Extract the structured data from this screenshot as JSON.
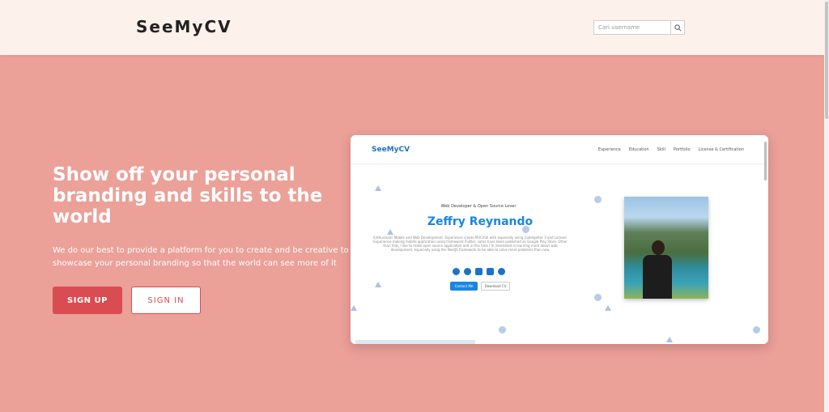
{
  "header": {
    "logo": "SeeMyCV",
    "search_placeholder": "Cari username",
    "search_icon": "search-icon"
  },
  "hero": {
    "title": "Show off your personal branding and skills to the world",
    "description": "We do our best to provide a platform for you to create and be creative to showcase your personal branding so that the world can see more of it",
    "signup_label": "SIGN UP",
    "signin_label": "SIGN IN"
  },
  "preview": {
    "logo": "SeeMyCV",
    "menu": [
      "Experience",
      "Education",
      "Skill",
      "Portfolio",
      "License & Certification"
    ],
    "subtitle": "Web Developer & Open Source Lover",
    "name": "Zeffry Reynando",
    "paragraph": "Enthusiastic Mobile and Web Development. Experience create MVC/full with especially using CodeIgniter 3 and Laravel. Experience making mobile application using framework Flutter, some have been published on Google Play Store. Other than that, I like to make open source application and in this time I'm interested in learning more about web development, especially using the NextJS framework to be able to solve more problems than now.",
    "social_icons": [
      "globe-icon",
      "facebook-icon",
      "instagram-icon",
      "linkedin-icon",
      "github-icon"
    ],
    "contact_label": "Contact Me",
    "download_label": "Download CV"
  },
  "colors": {
    "background": "#eba098",
    "header_bg": "#fdf1ec",
    "accent": "#d94d52",
    "preview_accent": "#1a86e0"
  }
}
